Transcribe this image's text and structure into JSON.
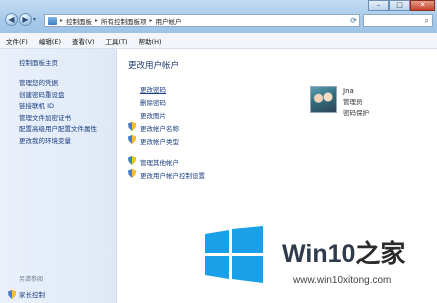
{
  "window": {
    "breadcrumbs": [
      "控制面板",
      "所有控制面板项",
      "用户帐户"
    ],
    "min_label": "–",
    "max_label": "□",
    "close_label": "✕"
  },
  "menu": [
    "文件(F)",
    "编辑(E)",
    "查看(V)",
    "工具(T)",
    "帮助(H)"
  ],
  "sidebar": {
    "home": "控制面板主页",
    "links": [
      "管理您的凭据",
      "创建密码重设盘",
      "链接联机 ID",
      "管理文件加密证书",
      "配置高级用户配置文件属性",
      "更改我的环境变量"
    ],
    "see_also": "另请参阅",
    "parental": "家长控制"
  },
  "main": {
    "title": "更改用户帐户",
    "actions": [
      {
        "label": "更改密码",
        "shield": false,
        "underline": true
      },
      {
        "label": "删除密码",
        "shield": false,
        "underline": false
      },
      {
        "label": "更改图片",
        "shield": false,
        "underline": false
      },
      {
        "label": "更改帐户名称",
        "shield": true,
        "underline": false
      },
      {
        "label": "更改帐户类型",
        "shield": true,
        "underline": false
      }
    ],
    "admin_actions": [
      {
        "label": "管理其他帐户",
        "shield": true
      },
      {
        "label": "更改用户帐户控制设置",
        "shield": true
      }
    ]
  },
  "user": {
    "name": "Jna",
    "role": "管理员",
    "status": "密码保护"
  },
  "watermark": {
    "brand_prefix": "Win10",
    "brand_suffix": "之家",
    "url": "www.win10xitong.com"
  },
  "colors": {
    "link": "#1c3f80",
    "logo_blue": "#1aa0e8"
  }
}
